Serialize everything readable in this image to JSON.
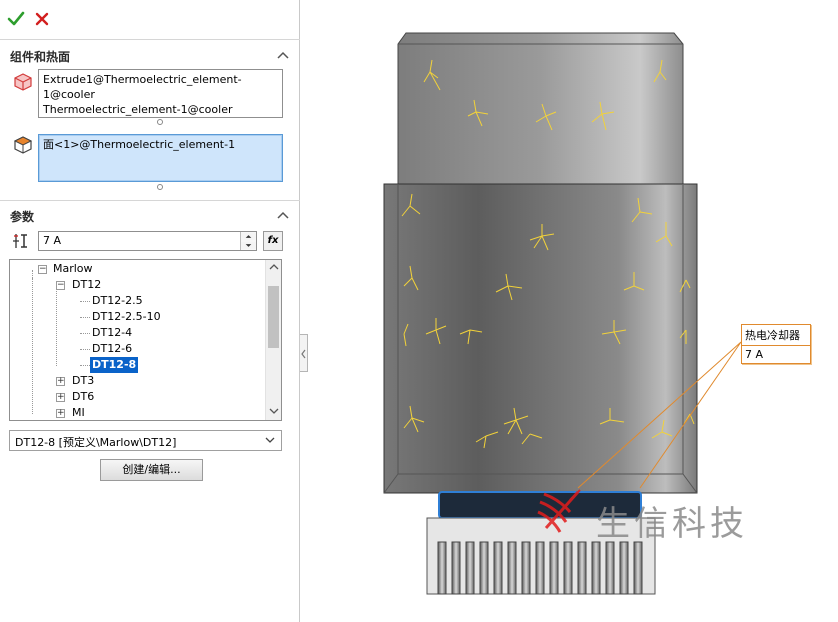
{
  "panel": {
    "components_section": {
      "title": "组件和热面",
      "components": [
        "Extrude1@Thermoelectric_element-1@cooler",
        "Thermoelectric_element-1@cooler"
      ],
      "hot_face": [
        "面<1>@Thermoelectric_element-1"
      ]
    },
    "params_section": {
      "title": "参数",
      "current_value": "7 A",
      "fx_label": "fx",
      "tree": {
        "root": "Marlow",
        "group": "DT12",
        "items": [
          "DT12-2.5",
          "DT12-2.5-10",
          "DT12-4",
          "DT12-6",
          "DT12-8"
        ],
        "selected": "DT12-8",
        "siblings": [
          "DT3",
          "DT6",
          "MI"
        ]
      },
      "selected_desc": "DT12-8 [预定义\\Marlow\\DT12]",
      "edit_button": "创建/编辑..."
    }
  },
  "callout": {
    "title": "热电冷却器",
    "value": "7 A"
  },
  "watermark": "生信科技",
  "colors": {
    "accent": "#0a63c9",
    "callout_border": "#e08a2e",
    "ok": "#2e9e2e",
    "cancel": "#d21f1f"
  }
}
